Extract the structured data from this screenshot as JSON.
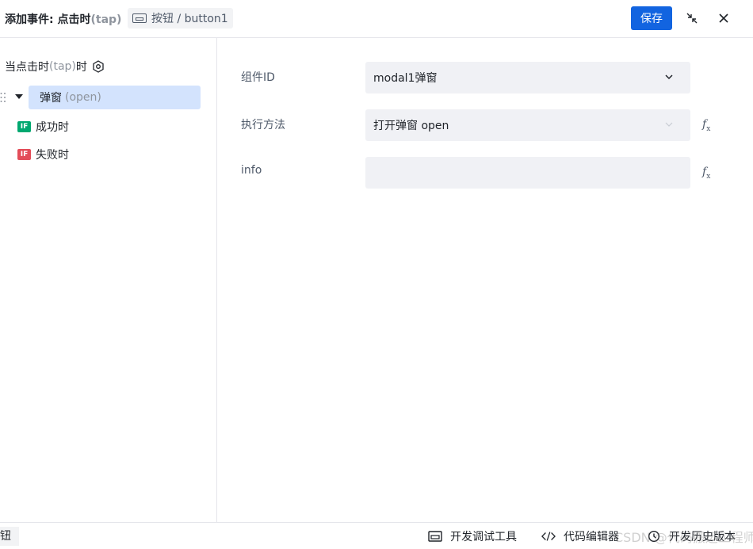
{
  "header": {
    "title_prefix": "添加事件: 点击时",
    "title_event": "(tap)",
    "component_tag": "按钮 / button1",
    "save_label": "保存",
    "icons": [
      "minimize-icon",
      "close-icon"
    ]
  },
  "left": {
    "trigger_label": "当点击时",
    "trigger_event": "(tap)",
    "trigger_suffix": "时",
    "action_name": "弹窗",
    "action_method": "(open)",
    "branches": [
      {
        "badge": "IF",
        "label": "成功时",
        "color": "#00a870"
      },
      {
        "badge": "IF",
        "label": "失败时",
        "color": "#e34d59"
      }
    ]
  },
  "form": {
    "fields": [
      {
        "label": "组件ID",
        "value": "modal1弹窗",
        "type": "select"
      },
      {
        "label": "执行方法",
        "value": "打开弹窗 open",
        "type": "select-disabled"
      },
      {
        "label": "info",
        "value": "",
        "type": "input"
      }
    ],
    "fx_label": "f",
    "fx_sub": "x"
  },
  "footer": {
    "left_text": "钮",
    "tools": [
      {
        "label": "开发调试工具",
        "icon": "debug-panel-icon"
      },
      {
        "label": "代码编辑器",
        "icon": "code-icon"
      },
      {
        "label": "开发历史版本",
        "icon": "history-icon"
      }
    ],
    "watermark": "CSDN @代码搬运工程师"
  },
  "colors": {
    "primary": "#1264e0",
    "selected_bg": "#d3e3fd",
    "field_bg": "#f0f1f5",
    "success": "#00a870",
    "fail": "#e34d59"
  }
}
